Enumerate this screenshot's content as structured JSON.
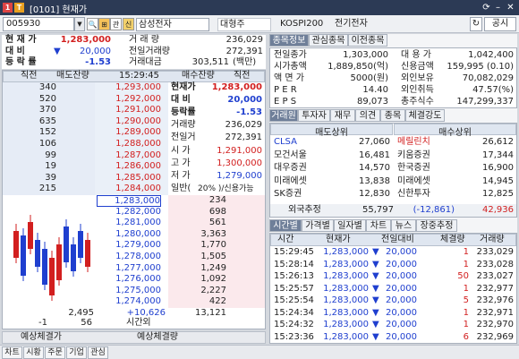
{
  "window": {
    "title": "[0101] 현재가",
    "icon_left": "1",
    "icon_right": "T"
  },
  "toolbar": {
    "code": "005930",
    "btn_a": "관",
    "btn_b": "신",
    "stock_name": "삼성전자",
    "owner": "대형주",
    "index": "KOSPI200",
    "sector": "전기전자",
    "public_btn": "공시"
  },
  "summary": {
    "price_label": "현 재 가",
    "price": "1,283,000",
    "change_label": "대   비",
    "change": "20,000",
    "rate_label": "등 락 률",
    "rate": "-1.53",
    "vol_label": "거 래 량",
    "vol": "236,029",
    "prev_vol_label": "전일거래량",
    "prev_vol": "272,391",
    "amount_label": "거래대금",
    "amount": "303,511",
    "amount_unit": "(백만)"
  },
  "order_head": {
    "c1": "직전",
    "c2": "매도잔량",
    "time": "15:29:45",
    "c4": "매수잔량",
    "c5": "직전"
  },
  "asks": [
    {
      "prev": "340",
      "qty": "",
      "price": "1,293,000"
    },
    {
      "prev": "520",
      "qty": "",
      "price": "1,292,000"
    },
    {
      "prev": "370",
      "qty": "",
      "price": "1,291,000"
    },
    {
      "prev": "635",
      "qty": "",
      "price": "1,290,000"
    },
    {
      "prev": "152",
      "qty": "",
      "price": "1,289,000"
    },
    {
      "prev": "106",
      "qty": "",
      "price": "1,288,000"
    },
    {
      "prev": "99",
      "qty": "",
      "price": "1,287,000"
    },
    {
      "prev": "19",
      "qty": "",
      "price": "1,286,000"
    },
    {
      "prev": "39",
      "qty": "",
      "price": "1,285,000"
    },
    {
      "prev": "215",
      "qty": "",
      "price": "1,284,000"
    }
  ],
  "bids": [
    {
      "price": "1,283,000",
      "qty": "234"
    },
    {
      "price": "1,282,000",
      "qty": "698"
    },
    {
      "price": "1,281,000",
      "qty": "561"
    },
    {
      "price": "1,280,000",
      "qty": "3,363"
    },
    {
      "price": "1,279,000",
      "qty": "1,770"
    },
    {
      "price": "1,278,000",
      "qty": "1,505"
    },
    {
      "price": "1,277,000",
      "qty": "1,249"
    },
    {
      "price": "1,276,000",
      "qty": "1,092"
    },
    {
      "price": "1,275,000",
      "qty": "2,227"
    },
    {
      "price": "1,274,000",
      "qty": "422"
    }
  ],
  "mid_info": {
    "rows": [
      {
        "label": "현재가",
        "value": "1,283,000"
      },
      {
        "label": "대  비",
        "value": "20,000"
      },
      {
        "label": "등락률",
        "value": "-1.53"
      },
      {
        "label": "거래량",
        "value": "236,029"
      },
      {
        "label": "전일거",
        "value": "272,391"
      },
      {
        "label": "시  가",
        "value": "1,291,000"
      },
      {
        "label": "고  가",
        "value": "1,300,000"
      },
      {
        "label": "저  가",
        "value": "1,279,000"
      },
      {
        "label": "일반(",
        "value": "20%  )/신용가능"
      }
    ]
  },
  "totals": {
    "ask_total": "2,495",
    "ask_diff": "-1",
    "center_plus": "+10,626",
    "bid_total": "13,121",
    "bid_diff": "56",
    "time_外": "시간외"
  },
  "expected": {
    "left": "예상체결가",
    "right": "예상체결량"
  },
  "right_tabs1": [
    "종목정보",
    "관심종목",
    "이전종목"
  ],
  "info": [
    {
      "k": "전일종가",
      "v": "1,303,000",
      "k2": "대 용 가",
      "v2": "1,042,400"
    },
    {
      "k": "시가총액",
      "v": "1,889,850(억)",
      "k2": "신용금액",
      "v2": "159,995  (0.10)"
    },
    {
      "k": "액 면 가",
      "v": "5000(원)",
      "k2": "외인보유",
      "v2": "70,082,029"
    },
    {
      "k": "P E R",
      "v": "14.40",
      "k2": "외인취득",
      "v2": "47.57(%)"
    },
    {
      "k": "E P S",
      "v": "89,073",
      "k2": "총주식수",
      "v2": "147,299,337"
    }
  ],
  "right_tabs2": [
    "거래원",
    "투자자",
    "재무",
    "의견",
    "종목",
    "체결강도"
  ],
  "broker_head": {
    "sell": "매도상위",
    "buy": "매수상위"
  },
  "brokers": [
    {
      "s": "CLSA",
      "sv": "27,060",
      "b": "메릴린치",
      "bv": "26,612"
    },
    {
      "s": "모건서울",
      "sv": "16,481",
      "b": "키움증권",
      "bv": "17,344"
    },
    {
      "s": "대우증권",
      "sv": "14,570",
      "b": "한국증권",
      "bv": "16,900"
    },
    {
      "s": "미래에셋",
      "sv": "13,838",
      "b": "미래에셋",
      "bv": "14,945"
    },
    {
      "s": "SK증권",
      "sv": "12,830",
      "b": "신한투자",
      "bv": "12,825"
    }
  ],
  "foreign": {
    "label": "외국추정",
    "sell": "55,797",
    "diff": "(-12,861)",
    "buy": "42,936"
  },
  "right_tabs3": [
    "시간별",
    "가격별",
    "일자별",
    "차트",
    "뉴스",
    "장중추정"
  ],
  "trade_head": [
    "시간",
    "현재가",
    "전일대비",
    "체결량",
    "거래량"
  ],
  "trades": [
    {
      "t": "15:29:45",
      "p": "1,283,000",
      "d": "20,000",
      "q": "1",
      "v": "233,029"
    },
    {
      "t": "15:28:14",
      "p": "1,283,000",
      "d": "20,000",
      "q": "1",
      "v": "233,028"
    },
    {
      "t": "15:26:13",
      "p": "1,283,000",
      "d": "20,000",
      "q": "50",
      "v": "233,027"
    },
    {
      "t": "15:25:57",
      "p": "1,283,000",
      "d": "20,000",
      "q": "1",
      "v": "232,977"
    },
    {
      "t": "15:25:54",
      "p": "1,283,000",
      "d": "20,000",
      "q": "5",
      "v": "232,976"
    },
    {
      "t": "15:24:34",
      "p": "1,283,000",
      "d": "20,000",
      "q": "1",
      "v": "232,971"
    },
    {
      "t": "15:24:32",
      "p": "1,283,000",
      "d": "20,000",
      "q": "1",
      "v": "232,970"
    },
    {
      "t": "15:23:36",
      "p": "1,283,000",
      "d": "20,000",
      "q": "6",
      "v": "232,969"
    }
  ],
  "bottom_tabs": [
    "차트",
    "시황",
    "주문",
    "기업",
    "관심"
  ]
}
